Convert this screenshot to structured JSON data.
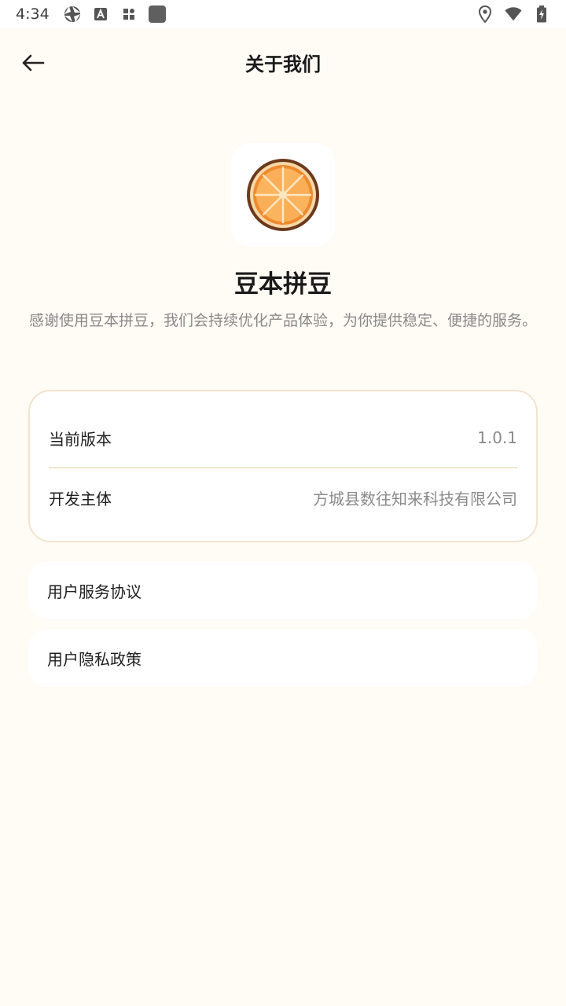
{
  "status_bar": {
    "time": "4:34",
    "left_icons": [
      "aperture-icon",
      "font-a-icon",
      "widgets-icon",
      "app-square-icon"
    ],
    "right_icons": [
      "location-icon",
      "wifi-icon",
      "battery-charging-icon"
    ]
  },
  "header": {
    "title": "关于我们",
    "back_icon": "arrow-left-icon"
  },
  "app": {
    "icon": "orange-slice-icon",
    "name": "豆本拼豆",
    "description": "感谢使用豆本拼豆，我们会持续优化产品体验，为你提供稳定、便捷的服务。"
  },
  "info": {
    "version_label": "当前版本",
    "version_value": "1.0.1",
    "developer_label": "开发主体",
    "developer_value": "方城县数往知来科技有限公司"
  },
  "links": {
    "user_agreement": "用户服务协议",
    "privacy_policy": "用户隐私政策"
  },
  "colors": {
    "background": "#fffbf5",
    "card_border": "#f1e4cf",
    "orange": "#f39a3c"
  }
}
